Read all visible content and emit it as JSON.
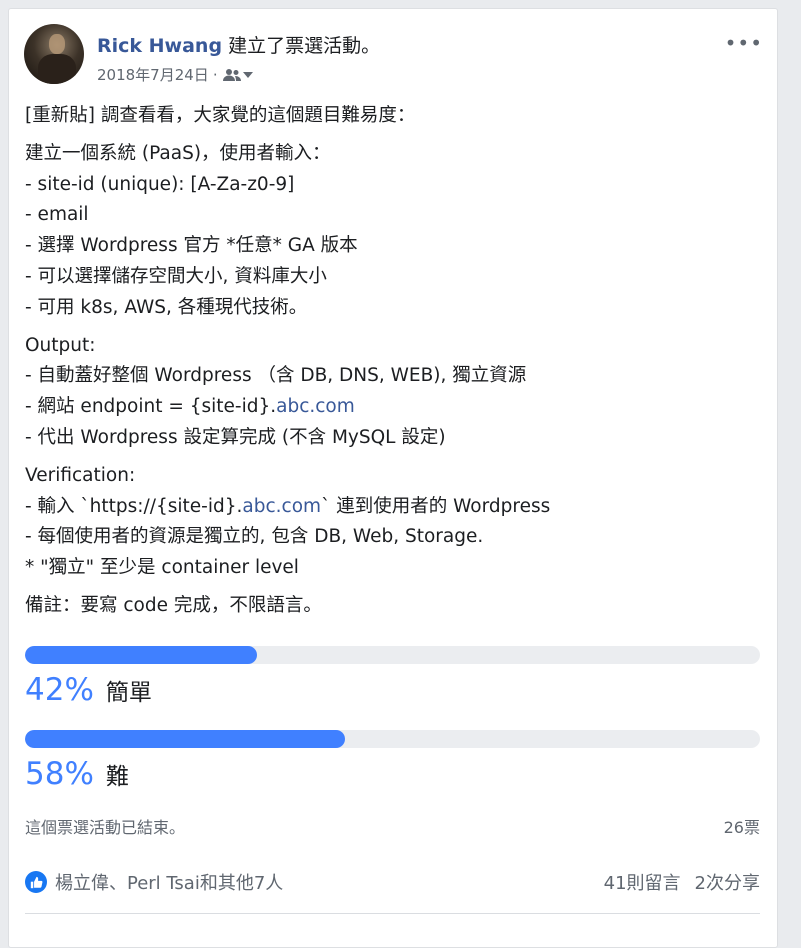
{
  "post": {
    "author": "Rick Hwang",
    "action": "建立了票選活動。",
    "date": "2018年7月24日",
    "meta_sep": "·",
    "audience_icon": "friends-icon",
    "more_label": "•••"
  },
  "body": {
    "intro": "[重新貼] 調查看看，大家覺的這個題目難易度：",
    "spec_lines": [
      "建立一個系統 (PaaS)，使用者輸入：",
      "- site-id (unique): [A-Za-z0-9]",
      "- email",
      "- 選擇 Wordpress 官方 *任意* GA 版本",
      "- 可以選擇儲存空間大小, 資料庫大小",
      "- 可用 k8s, AWS, 各種現代技術。"
    ],
    "output_title": "Output:",
    "output_line1": "- 自動蓋好整個 Wordpress （含 DB, DNS, WEB), 獨立資源",
    "output_line2_pre": "- 網站 endpoint = {site-id}.",
    "output_line2_link": "abc.com",
    "output_line3": "- 代出 Wordpress 設定算完成 (不含 MySQL 設定)",
    "verification_title": "Verification:",
    "ver_line1_pre": "- 輸入 `https://{site-id}.",
    "ver_line1_link": "abc.com",
    "ver_line1_post": "` 連到使用者的 Wordpress",
    "ver_line2": "- 每個使用者的資源是獨立的, 包含 DB, Web, Storage.",
    "ver_line3": "* \"獨立\" 至少是 container level",
    "note": "備註：要寫 code 完成，不限語言。"
  },
  "poll": {
    "options": [
      {
        "label": "簡單",
        "percent": 42,
        "percent_text": "42%"
      },
      {
        "label": "難",
        "percent": 58,
        "percent_text": "58%"
      }
    ],
    "status": "這個票選活動已結束。",
    "votes": "26票",
    "bar_color": "#4080ff"
  },
  "reactions": {
    "like_icon": "thumbs-up-icon",
    "likers": "楊立偉、Perl Tsai和其他7人",
    "comments": "41則留言",
    "shares": "2次分享"
  }
}
